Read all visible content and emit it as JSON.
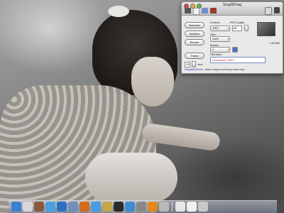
{
  "window": {
    "title": "SnapNDrag",
    "buttons": {
      "selection": "Selection",
      "window": "Window",
      "screen": "Screen",
      "timed": "Timed"
    },
    "delay": {
      "value": "10",
      "unit": "secs"
    },
    "format": {
      "label": "Format:",
      "value": "JPEG",
      "quality_label": "JPEG Quality",
      "quality_value": "85"
    },
    "size": {
      "label": "Size:",
      "value": "100%"
    },
    "border": {
      "label": "Border:",
      "value": "0"
    },
    "file_size": "1.45 MB",
    "filename": {
      "label": "Filename:",
      "value": "screenshot_0002"
    },
    "footer": {
      "link": "EasyBatchPhoto",
      "text": " - Batch image processing made easy"
    }
  },
  "dock": {
    "icons": [
      {
        "name": "finder-icon",
        "color": "#3b7fd1"
      },
      {
        "name": "mail-icon",
        "color": "#d8d8d8"
      },
      {
        "name": "user-icon",
        "color": "#8a5a3c"
      },
      {
        "name": "safari-icon",
        "color": "#4aa0e0"
      },
      {
        "name": "ical-icon",
        "color": "#2d6fc4"
      },
      {
        "name": "photo-icon",
        "color": "#6f8fb8"
      },
      {
        "name": "firefox-icon",
        "color": "#d46a1c"
      },
      {
        "name": "ichat-icon",
        "color": "#4b9be0"
      },
      {
        "name": "preview-icon",
        "color": "#c2a64a"
      },
      {
        "name": "terminal-icon",
        "color": "#2b2b2b"
      },
      {
        "name": "itunes-icon",
        "color": "#3f8ad0"
      },
      {
        "name": "gear-icon",
        "color": "#888888"
      },
      {
        "name": "vlc-icon",
        "color": "#e08a20"
      },
      {
        "name": "snapndrag-icon",
        "color": "#b8b8b8"
      },
      {
        "name": "window1-icon",
        "color": "#e6e6e6"
      },
      {
        "name": "window2-icon",
        "color": "#f0f0f0"
      },
      {
        "name": "trash-icon",
        "color": "#c8c8c8"
      }
    ]
  }
}
